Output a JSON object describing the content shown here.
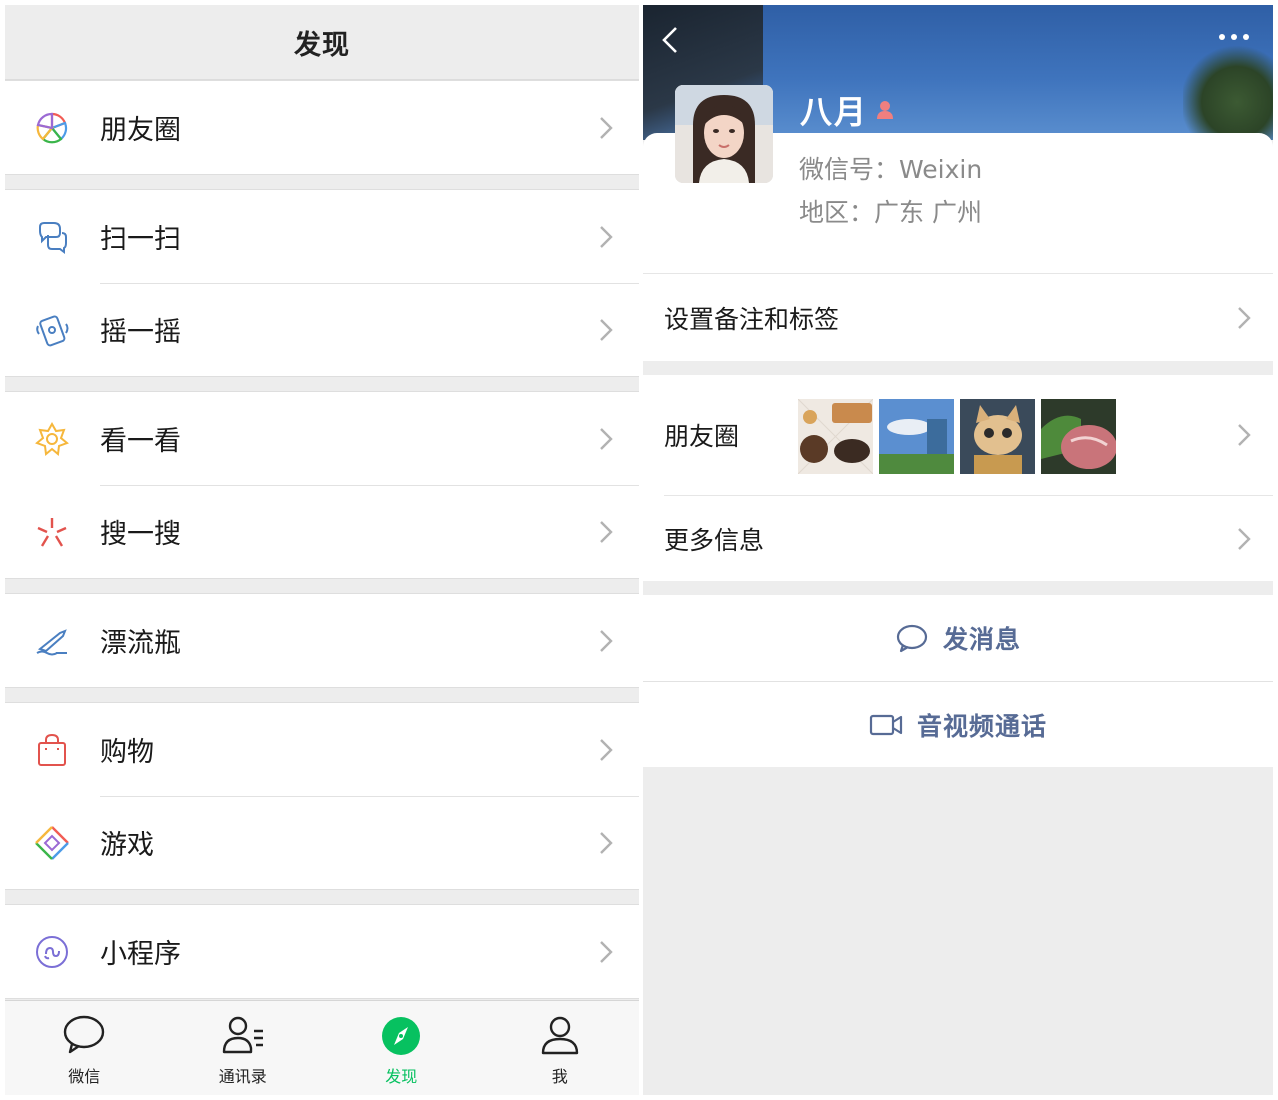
{
  "discover": {
    "title": "发现",
    "groups": [
      [
        {
          "label": "朋友圈",
          "icon": "moments-icon"
        }
      ],
      [
        {
          "label": "扫一扫",
          "icon": "scan-icon"
        },
        {
          "label": "摇一摇",
          "icon": "shake-icon"
        }
      ],
      [
        {
          "label": "看一看",
          "icon": "top-stories-icon"
        },
        {
          "label": "搜一搜",
          "icon": "search-icon"
        }
      ],
      [
        {
          "label": "漂流瓶",
          "icon": "drift-bottle-icon"
        }
      ],
      [
        {
          "label": "购物",
          "icon": "shopping-bag-icon"
        },
        {
          "label": "游戏",
          "icon": "games-icon"
        }
      ],
      [
        {
          "label": "小程序",
          "icon": "mini-program-icon"
        }
      ]
    ]
  },
  "tabbar": {
    "tabs": [
      {
        "label": "微信",
        "icon": "chat-bubble-icon",
        "active": false
      },
      {
        "label": "通讯录",
        "icon": "contacts-icon",
        "active": false
      },
      {
        "label": "发现",
        "icon": "compass-icon",
        "active": true
      },
      {
        "label": "我",
        "icon": "me-icon",
        "active": false
      }
    ],
    "active_color": "#07c160"
  },
  "profile": {
    "name": "八月",
    "weixin_id": "微信号：Weixin",
    "region": "地区：广东 广州",
    "gender_icon": "female-icon",
    "set_remark": "设置备注和标签",
    "moments_label": "朋友圈",
    "more_info": "更多信息",
    "send_message": "发消息",
    "video_call": "音视频通话",
    "link_color": "#576b95"
  }
}
